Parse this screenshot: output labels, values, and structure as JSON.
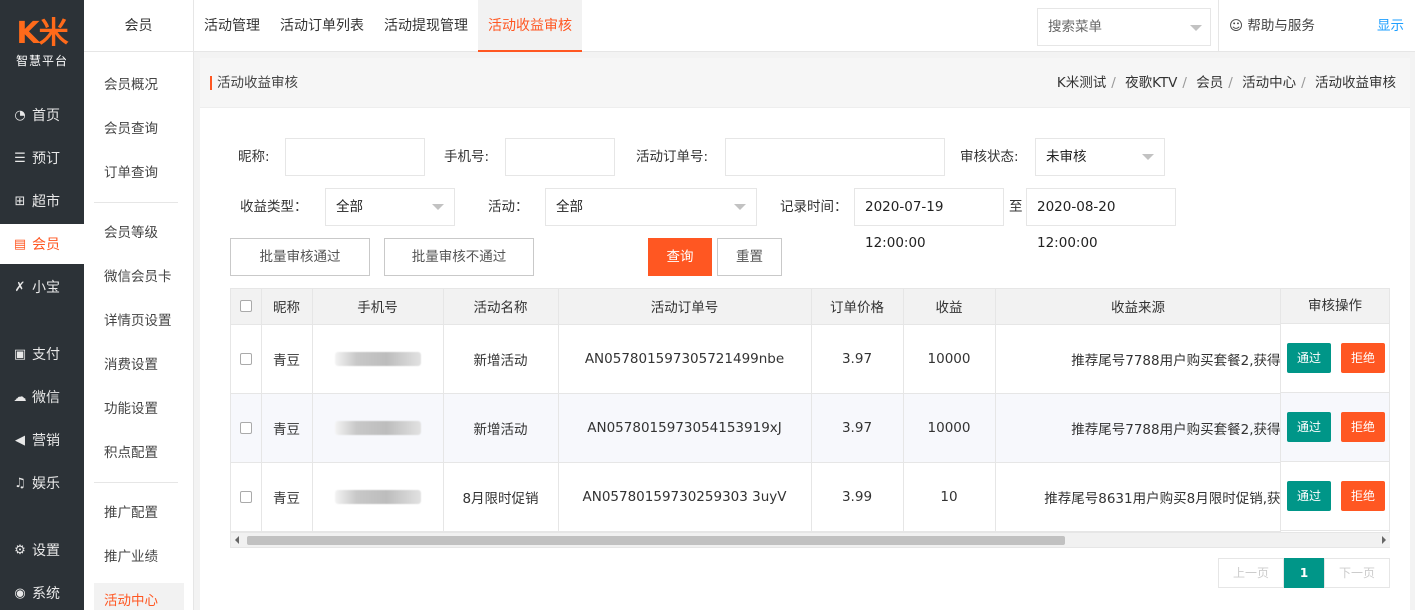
{
  "logo": {
    "mark": "K米",
    "sub": "智慧平台"
  },
  "nav": [
    {
      "label": "首页",
      "icon": "dashboard-icon",
      "glyph": "◔"
    },
    {
      "label": "预订",
      "icon": "booking-icon",
      "glyph": "☰"
    },
    {
      "label": "超市",
      "icon": "shop-icon",
      "glyph": "⊞"
    },
    {
      "label": "会员",
      "icon": "member-card-icon",
      "glyph": "▤"
    },
    {
      "label": "小宝",
      "icon": "assistant-icon",
      "glyph": "✗"
    },
    {
      "label": "支付",
      "icon": "payment-icon",
      "glyph": "▣"
    },
    {
      "label": "微信",
      "icon": "wechat-icon",
      "glyph": "☁"
    },
    {
      "label": "营销",
      "icon": "megaphone-icon",
      "glyph": "◀"
    },
    {
      "label": "娱乐",
      "icon": "entertainment-icon",
      "glyph": "♫"
    },
    {
      "label": "设置",
      "icon": "settings-icon",
      "glyph": "⚙"
    },
    {
      "label": "系统",
      "icon": "system-icon",
      "glyph": "◉"
    }
  ],
  "submenu": {
    "title": "会员",
    "items": [
      "会员概况",
      "会员查询",
      "订单查询",
      "会员等级",
      "微信会员卡",
      "详情页设置",
      "消费设置",
      "功能设置",
      "积点配置",
      "推广配置",
      "推广业绩",
      "活动中心"
    ]
  },
  "tabs": [
    "活动管理",
    "活动订单列表",
    "活动提现管理",
    "活动收益审核"
  ],
  "search_menu": {
    "placeholder": "搜索菜单"
  },
  "help": {
    "label": "帮助与服务",
    "icon": "smile-icon",
    "glyph": "☺"
  },
  "show_label": "显示",
  "page": {
    "title": "活动收益审核",
    "breadcrumbs": [
      "K米测试",
      "夜歌KTV",
      "会员",
      "活动中心",
      "活动收益审核"
    ]
  },
  "filters": {
    "nickname_label": "昵称:",
    "nickname_value": "",
    "phone_label": "手机号:",
    "phone_value": "",
    "order_no_label": "活动订单号:",
    "order_no_value": "",
    "status_label": "审核状态:",
    "status_value": "未审核",
    "income_type_label": "收益类型：",
    "income_type_value": "全部",
    "activity_label": "活动：",
    "activity_value": "全部",
    "time_label": "记录时间：",
    "time_start": "2020-07-19 12:00:00",
    "time_to": "至",
    "time_end": "2020-08-20 12:00:00"
  },
  "actions": {
    "batch_pass": "批量审核通过",
    "batch_reject": "批量审核不通过",
    "query": "查询",
    "reset": "重置"
  },
  "table": {
    "headers": [
      "昵称",
      "手机号",
      "活动名称",
      "活动订单号",
      "订单价格",
      "收益",
      "收益来源",
      "审核操作"
    ],
    "rows": [
      {
        "nickname": "青豆",
        "activity": "新增活动",
        "order_no": "AN057801597305721499nbe",
        "price": "3.97",
        "income": "10000",
        "source": "推荐尾号7788用户购买套餐2,获得"
      },
      {
        "nickname": "青豆",
        "activity": "新增活动",
        "order_no": "AN0578015973054153919xJ",
        "price": "3.97",
        "income": "10000",
        "source": "推荐尾号7788用户购买套餐2,获得"
      },
      {
        "nickname": "青豆",
        "activity": "8月限时促销",
        "order_no": "AN05780159730259303 3uyV",
        "price": "3.99",
        "income": "10",
        "source": "推荐尾号8631用户购买8月限时促销,获"
      }
    ],
    "pass_label": "通过",
    "reject_label": "拒绝"
  },
  "pagination": {
    "prev": "上一页",
    "current": "1",
    "next": "下一页"
  },
  "colors": {
    "accent": "#ff5722",
    "pass": "#009688",
    "sidebar": "#2c3237",
    "link": "#1e9fff"
  }
}
